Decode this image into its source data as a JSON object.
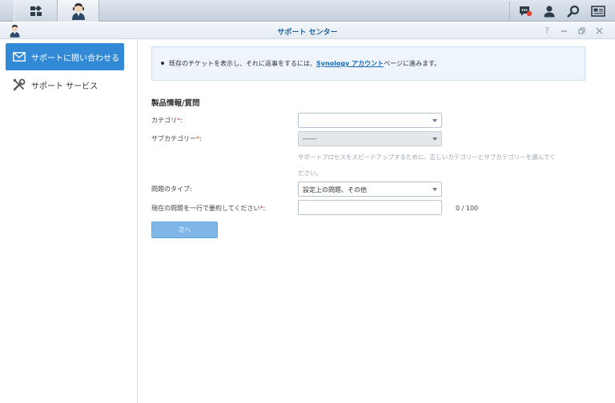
{
  "window": {
    "title": "サポート センター"
  },
  "sidebar": {
    "items": [
      {
        "label": "サポートに問い合わせる",
        "icon": "mail-icon",
        "active": true
      },
      {
        "label": "サポート サービス",
        "icon": "tools-icon",
        "active": false
      }
    ]
  },
  "notice": {
    "text_before": "既存のチケットを表示し、それに返事をするには、",
    "link": "Synology アカウント",
    "text_after": "ページに進みます。"
  },
  "form": {
    "section_title": "製品情報/質問",
    "category_label": "カテゴリ",
    "category_suffix": ":",
    "category_value": "",
    "subcategory_label": "サブカテゴリー",
    "subcategory_suffix": ":",
    "subcategory_value": "------",
    "hint_line1": "サポートプロセスをスピードアップするために、正しいカテゴリーとサブカテゴリーを選んでく",
    "hint_line2": "ださい。",
    "issue_type_label": "問題のタイプ:",
    "issue_type_value": "設定上の問題、その他",
    "summary_label": "現在の問題を一行で要約してください",
    "summary_suffix": ":",
    "summary_value": "",
    "required_mark": "*",
    "counter": "0 / 100",
    "next_label": "次へ"
  },
  "colors": {
    "accent": "#3289d6",
    "link": "#1a6ab6",
    "required": "#d2453b",
    "button_disabled": "#7fb6e8"
  }
}
